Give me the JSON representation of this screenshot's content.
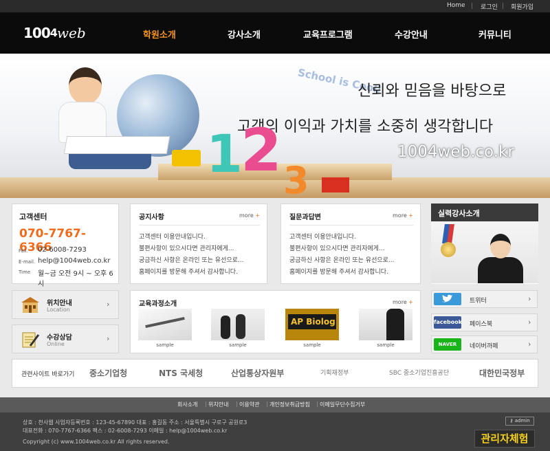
{
  "topbar": {
    "links": [
      "Home",
      "로그인",
      "회원가입"
    ]
  },
  "logo": {
    "text": "100",
    "four": "4",
    "web": "web"
  },
  "nav": {
    "items": [
      "학원소개",
      "강사소개",
      "교육프로그램",
      "수강안내",
      "커뮤니티"
    ],
    "active_index": 0
  },
  "hero": {
    "school_text": "School is Cool!",
    "line1": "신뢰와 믿음을 바탕으로",
    "line2": "고객의 이익과 가치를 소중히 생각합니다",
    "site": "1004web.co.kr",
    "num1": "1",
    "num2": "2",
    "num3": "3"
  },
  "customer_center": {
    "title": "고객센터",
    "phone": "070-7767-6366",
    "fax_label": "Fax.",
    "fax": "02-6008-7293",
    "email_label": "E-mail.",
    "email": "help@1004web.co.kr",
    "time_label": "Time",
    "time": "월~금 오전 9시 ~ 오후 6시"
  },
  "notice": {
    "title": "공지사항",
    "more": "more",
    "items": [
      "고객센터 이용안내입니다.",
      "불편사항이 있으시다면 관리자에게...",
      "궁금하신 사항은 온라인 또는 유선으로...",
      "홈페이지를 방문해 주셔서 감사합니다."
    ]
  },
  "qna": {
    "title": "질문과답변",
    "more": "more",
    "items": [
      "고객센터 이용안내입니다.",
      "불편사항이 있으시다면 관리자에게...",
      "궁금하신 사항은 온라인 또는 유선으로...",
      "홈페이지를 방문해 주셔서 감사합니다."
    ]
  },
  "lecturer": {
    "title": "실력강사소개"
  },
  "location": {
    "title": "위치안내",
    "sub": "Location"
  },
  "consult": {
    "title": "수강상담",
    "sub": "Online"
  },
  "courses": {
    "title": "교육과정소개",
    "more": "more",
    "captions": [
      "sample",
      "sample",
      "sample",
      "sample"
    ],
    "book_title": "AP Biolog"
  },
  "sns": [
    {
      "logo": "twitter",
      "label": "트위터",
      "color": "#3a9ad9"
    },
    {
      "logo": "facebook",
      "label": "페이스북",
      "color": "#3b5998"
    },
    {
      "logo": "NAVER",
      "label": "네이버까페",
      "color": "#19b419"
    }
  ],
  "related": {
    "title": "관련사이트 바로가기",
    "orgs": [
      "중소기업청",
      "NTS 국세청",
      "산업통상자원부",
      "기획재정부",
      "SBC 중소기업진흥공단",
      "대한민국정부"
    ]
  },
  "footer": {
    "links": [
      "회사소개",
      "위치안내",
      "이용약관",
      "개인정보취급방침",
      "이메일무단수집거부"
    ],
    "line1": "상호 : 천사웹  사업자등록번호 : 123-45-67890  대표 : 홍길동  주소 : 서울특별시 구로구 공원로3",
    "line2": "대표전화 : 070-7767-6366  팩스 : 02-6008-7293  이메일 : help@1004web.co.kr",
    "copyright": "Copyright (c) www.1004web.co.kr All rights reserved.",
    "admin": "admin",
    "admin_experience": "관리자체험"
  }
}
